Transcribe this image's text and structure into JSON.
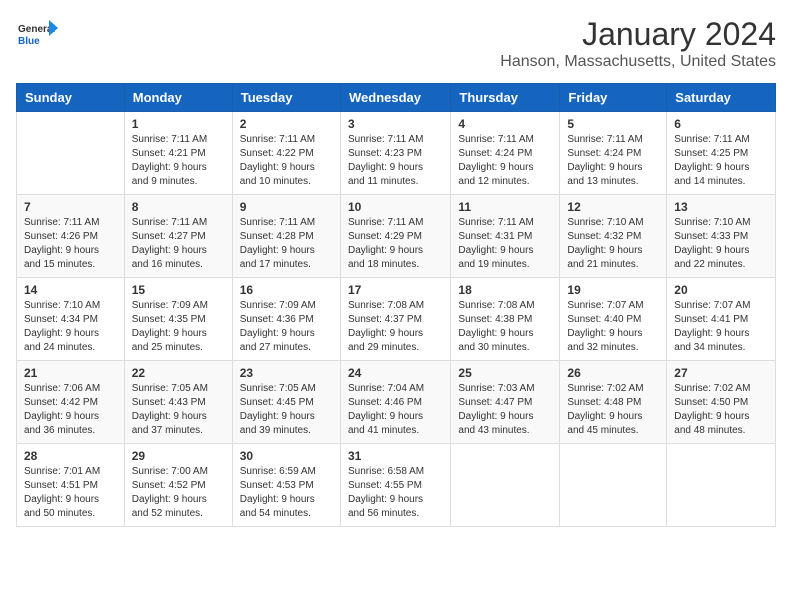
{
  "header": {
    "logo_general": "General",
    "logo_blue": "Blue",
    "month_year": "January 2024",
    "location": "Hanson, Massachusetts, United States"
  },
  "weekdays": [
    "Sunday",
    "Monday",
    "Tuesday",
    "Wednesday",
    "Thursday",
    "Friday",
    "Saturday"
  ],
  "weeks": [
    [
      {
        "day": "",
        "detail": ""
      },
      {
        "day": "1",
        "detail": "Sunrise: 7:11 AM\nSunset: 4:21 PM\nDaylight: 9 hours\nand 9 minutes."
      },
      {
        "day": "2",
        "detail": "Sunrise: 7:11 AM\nSunset: 4:22 PM\nDaylight: 9 hours\nand 10 minutes."
      },
      {
        "day": "3",
        "detail": "Sunrise: 7:11 AM\nSunset: 4:23 PM\nDaylight: 9 hours\nand 11 minutes."
      },
      {
        "day": "4",
        "detail": "Sunrise: 7:11 AM\nSunset: 4:24 PM\nDaylight: 9 hours\nand 12 minutes."
      },
      {
        "day": "5",
        "detail": "Sunrise: 7:11 AM\nSunset: 4:24 PM\nDaylight: 9 hours\nand 13 minutes."
      },
      {
        "day": "6",
        "detail": "Sunrise: 7:11 AM\nSunset: 4:25 PM\nDaylight: 9 hours\nand 14 minutes."
      }
    ],
    [
      {
        "day": "7",
        "detail": "Sunrise: 7:11 AM\nSunset: 4:26 PM\nDaylight: 9 hours\nand 15 minutes."
      },
      {
        "day": "8",
        "detail": "Sunrise: 7:11 AM\nSunset: 4:27 PM\nDaylight: 9 hours\nand 16 minutes."
      },
      {
        "day": "9",
        "detail": "Sunrise: 7:11 AM\nSunset: 4:28 PM\nDaylight: 9 hours\nand 17 minutes."
      },
      {
        "day": "10",
        "detail": "Sunrise: 7:11 AM\nSunset: 4:29 PM\nDaylight: 9 hours\nand 18 minutes."
      },
      {
        "day": "11",
        "detail": "Sunrise: 7:11 AM\nSunset: 4:31 PM\nDaylight: 9 hours\nand 19 minutes."
      },
      {
        "day": "12",
        "detail": "Sunrise: 7:10 AM\nSunset: 4:32 PM\nDaylight: 9 hours\nand 21 minutes."
      },
      {
        "day": "13",
        "detail": "Sunrise: 7:10 AM\nSunset: 4:33 PM\nDaylight: 9 hours\nand 22 minutes."
      }
    ],
    [
      {
        "day": "14",
        "detail": "Sunrise: 7:10 AM\nSunset: 4:34 PM\nDaylight: 9 hours\nand 24 minutes."
      },
      {
        "day": "15",
        "detail": "Sunrise: 7:09 AM\nSunset: 4:35 PM\nDaylight: 9 hours\nand 25 minutes."
      },
      {
        "day": "16",
        "detail": "Sunrise: 7:09 AM\nSunset: 4:36 PM\nDaylight: 9 hours\nand 27 minutes."
      },
      {
        "day": "17",
        "detail": "Sunrise: 7:08 AM\nSunset: 4:37 PM\nDaylight: 9 hours\nand 29 minutes."
      },
      {
        "day": "18",
        "detail": "Sunrise: 7:08 AM\nSunset: 4:38 PM\nDaylight: 9 hours\nand 30 minutes."
      },
      {
        "day": "19",
        "detail": "Sunrise: 7:07 AM\nSunset: 4:40 PM\nDaylight: 9 hours\nand 32 minutes."
      },
      {
        "day": "20",
        "detail": "Sunrise: 7:07 AM\nSunset: 4:41 PM\nDaylight: 9 hours\nand 34 minutes."
      }
    ],
    [
      {
        "day": "21",
        "detail": "Sunrise: 7:06 AM\nSunset: 4:42 PM\nDaylight: 9 hours\nand 36 minutes."
      },
      {
        "day": "22",
        "detail": "Sunrise: 7:05 AM\nSunset: 4:43 PM\nDaylight: 9 hours\nand 37 minutes."
      },
      {
        "day": "23",
        "detail": "Sunrise: 7:05 AM\nSunset: 4:45 PM\nDaylight: 9 hours\nand 39 minutes."
      },
      {
        "day": "24",
        "detail": "Sunrise: 7:04 AM\nSunset: 4:46 PM\nDaylight: 9 hours\nand 41 minutes."
      },
      {
        "day": "25",
        "detail": "Sunrise: 7:03 AM\nSunset: 4:47 PM\nDaylight: 9 hours\nand 43 minutes."
      },
      {
        "day": "26",
        "detail": "Sunrise: 7:02 AM\nSunset: 4:48 PM\nDaylight: 9 hours\nand 45 minutes."
      },
      {
        "day": "27",
        "detail": "Sunrise: 7:02 AM\nSunset: 4:50 PM\nDaylight: 9 hours\nand 48 minutes."
      }
    ],
    [
      {
        "day": "28",
        "detail": "Sunrise: 7:01 AM\nSunset: 4:51 PM\nDaylight: 9 hours\nand 50 minutes."
      },
      {
        "day": "29",
        "detail": "Sunrise: 7:00 AM\nSunset: 4:52 PM\nDaylight: 9 hours\nand 52 minutes."
      },
      {
        "day": "30",
        "detail": "Sunrise: 6:59 AM\nSunset: 4:53 PM\nDaylight: 9 hours\nand 54 minutes."
      },
      {
        "day": "31",
        "detail": "Sunrise: 6:58 AM\nSunset: 4:55 PM\nDaylight: 9 hours\nand 56 minutes."
      },
      {
        "day": "",
        "detail": ""
      },
      {
        "day": "",
        "detail": ""
      },
      {
        "day": "",
        "detail": ""
      }
    ]
  ]
}
